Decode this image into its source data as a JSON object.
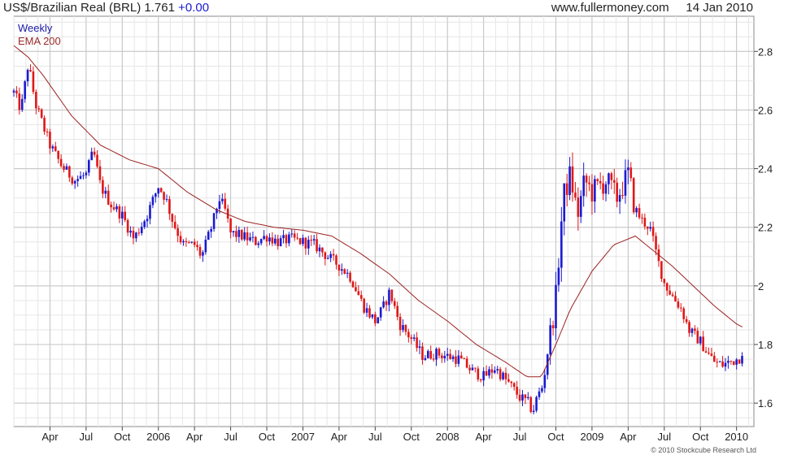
{
  "header": {
    "instrument": "US$/Brazilian Real (BRL)",
    "last": "1.761",
    "change": "+0.00",
    "site": "www.fullermoney.com",
    "date": "14 Jan 2010"
  },
  "legend": {
    "weekly": "Weekly",
    "ema": "EMA 200"
  },
  "copyright": "© 2010 Stockcube Research Ltd",
  "colors": {
    "up": "#1a1ad0",
    "down": "#e01818",
    "ema": "#9a2222",
    "grid_major": "#c4c4c4",
    "grid_minor": "#e6e6e6"
  },
  "chart_data": {
    "type": "candlestick",
    "title": "US$/Brazilian Real (BRL)",
    "frequency": "Weekly",
    "overlay": "EMA 200",
    "ylim": [
      1.52,
      2.92
    ],
    "yticks": [
      1.6,
      1.8,
      2,
      2.2,
      2.4,
      2.6,
      2.8
    ],
    "ytick_labels": [
      "1.6",
      "1.8",
      "2",
      "2.2",
      "2.4",
      "2.6",
      "2.8"
    ],
    "x_range": [
      2005.0,
      2010.12
    ],
    "xticks": [
      {
        "t": 2005.25,
        "label": "Apr"
      },
      {
        "t": 2005.5,
        "label": "Jul"
      },
      {
        "t": 2005.75,
        "label": "Oct"
      },
      {
        "t": 2006.0,
        "label": "2006"
      },
      {
        "t": 2006.25,
        "label": "Apr"
      },
      {
        "t": 2006.5,
        "label": "Jul"
      },
      {
        "t": 2006.75,
        "label": "Oct"
      },
      {
        "t": 2007.0,
        "label": "2007"
      },
      {
        "t": 2007.25,
        "label": "Apr"
      },
      {
        "t": 2007.5,
        "label": "Jul"
      },
      {
        "t": 2007.75,
        "label": "Oct"
      },
      {
        "t": 2008.0,
        "label": "2008"
      },
      {
        "t": 2008.25,
        "label": "Apr"
      },
      {
        "t": 2008.5,
        "label": "Jul"
      },
      {
        "t": 2008.75,
        "label": "Oct"
      },
      {
        "t": 2009.0,
        "label": "2009"
      },
      {
        "t": 2009.25,
        "label": "Apr"
      },
      {
        "t": 2009.5,
        "label": "Jul"
      },
      {
        "t": 2009.75,
        "label": "Oct"
      },
      {
        "t": 2010.0,
        "label": "2010"
      }
    ],
    "price_path": [
      [
        2005.0,
        2.66
      ],
      [
        2005.05,
        2.6
      ],
      [
        2005.1,
        2.76
      ],
      [
        2005.15,
        2.62
      ],
      [
        2005.25,
        2.48
      ],
      [
        2005.33,
        2.41
      ],
      [
        2005.42,
        2.36
      ],
      [
        2005.5,
        2.38
      ],
      [
        2005.55,
        2.46
      ],
      [
        2005.6,
        2.34
      ],
      [
        2005.67,
        2.28
      ],
      [
        2005.75,
        2.24
      ],
      [
        2005.83,
        2.16
      ],
      [
        2005.92,
        2.24
      ],
      [
        2006.0,
        2.34
      ],
      [
        2006.05,
        2.3
      ],
      [
        2006.1,
        2.22
      ],
      [
        2006.17,
        2.14
      ],
      [
        2006.25,
        2.14
      ],
      [
        2006.3,
        2.1
      ],
      [
        2006.38,
        2.22
      ],
      [
        2006.42,
        2.3
      ],
      [
        2006.46,
        2.26
      ],
      [
        2006.5,
        2.18
      ],
      [
        2006.58,
        2.17
      ],
      [
        2006.67,
        2.15
      ],
      [
        2006.75,
        2.17
      ],
      [
        2006.83,
        2.15
      ],
      [
        2006.92,
        2.16
      ],
      [
        2007.0,
        2.15
      ],
      [
        2007.08,
        2.14
      ],
      [
        2007.17,
        2.1
      ],
      [
        2007.25,
        2.07
      ],
      [
        2007.33,
        2.03
      ],
      [
        2007.42,
        1.93
      ],
      [
        2007.5,
        1.88
      ],
      [
        2007.55,
        1.92
      ],
      [
        2007.6,
        1.98
      ],
      [
        2007.67,
        1.87
      ],
      [
        2007.75,
        1.82
      ],
      [
        2007.83,
        1.76
      ],
      [
        2007.92,
        1.77
      ],
      [
        2008.0,
        1.76
      ],
      [
        2008.08,
        1.75
      ],
      [
        2008.17,
        1.71
      ],
      [
        2008.25,
        1.69
      ],
      [
        2008.33,
        1.72
      ],
      [
        2008.42,
        1.67
      ],
      [
        2008.5,
        1.62
      ],
      [
        2008.56,
        1.6
      ],
      [
        2008.59,
        1.57
      ],
      [
        2008.62,
        1.62
      ],
      [
        2008.66,
        1.66
      ],
      [
        2008.7,
        1.8
      ],
      [
        2008.75,
        1.96
      ],
      [
        2008.8,
        2.3
      ],
      [
        2008.85,
        2.38
      ],
      [
        2008.9,
        2.24
      ],
      [
        2008.95,
        2.36
      ],
      [
        2009.0,
        2.32
      ],
      [
        2009.05,
        2.34
      ],
      [
        2009.1,
        2.36
      ],
      [
        2009.17,
        2.3
      ],
      [
        2009.25,
        2.38
      ],
      [
        2009.3,
        2.26
      ],
      [
        2009.35,
        2.22
      ],
      [
        2009.4,
        2.2
      ],
      [
        2009.46,
        2.08
      ],
      [
        2009.5,
        2.01
      ],
      [
        2009.55,
        1.97
      ],
      [
        2009.62,
        1.92
      ],
      [
        2009.67,
        1.85
      ],
      [
        2009.75,
        1.81
      ],
      [
        2009.8,
        1.77
      ],
      [
        2009.85,
        1.74
      ],
      [
        2009.9,
        1.73
      ],
      [
        2009.95,
        1.74
      ],
      [
        2010.0,
        1.75
      ],
      [
        2010.04,
        1.76
      ]
    ],
    "ema_path": [
      [
        2005.0,
        2.82
      ],
      [
        2005.1,
        2.78
      ],
      [
        2005.2,
        2.72
      ],
      [
        2005.4,
        2.58
      ],
      [
        2005.6,
        2.48
      ],
      [
        2005.8,
        2.43
      ],
      [
        2006.0,
        2.4
      ],
      [
        2006.2,
        2.32
      ],
      [
        2006.4,
        2.26
      ],
      [
        2006.6,
        2.22
      ],
      [
        2006.8,
        2.2
      ],
      [
        2007.0,
        2.19
      ],
      [
        2007.2,
        2.17
      ],
      [
        2007.4,
        2.11
      ],
      [
        2007.6,
        2.04
      ],
      [
        2007.8,
        1.95
      ],
      [
        2008.0,
        1.88
      ],
      [
        2008.2,
        1.8
      ],
      [
        2008.4,
        1.74
      ],
      [
        2008.55,
        1.69
      ],
      [
        2008.65,
        1.69
      ],
      [
        2008.75,
        1.8
      ],
      [
        2008.85,
        1.92
      ],
      [
        2009.0,
        2.05
      ],
      [
        2009.15,
        2.14
      ],
      [
        2009.3,
        2.17
      ],
      [
        2009.4,
        2.13
      ],
      [
        2009.55,
        2.07
      ],
      [
        2009.7,
        2.0
      ],
      [
        2009.85,
        1.93
      ],
      [
        2010.0,
        1.87
      ],
      [
        2010.04,
        1.86
      ]
    ],
    "volatility": 0.025,
    "last_price": 1.761
  }
}
